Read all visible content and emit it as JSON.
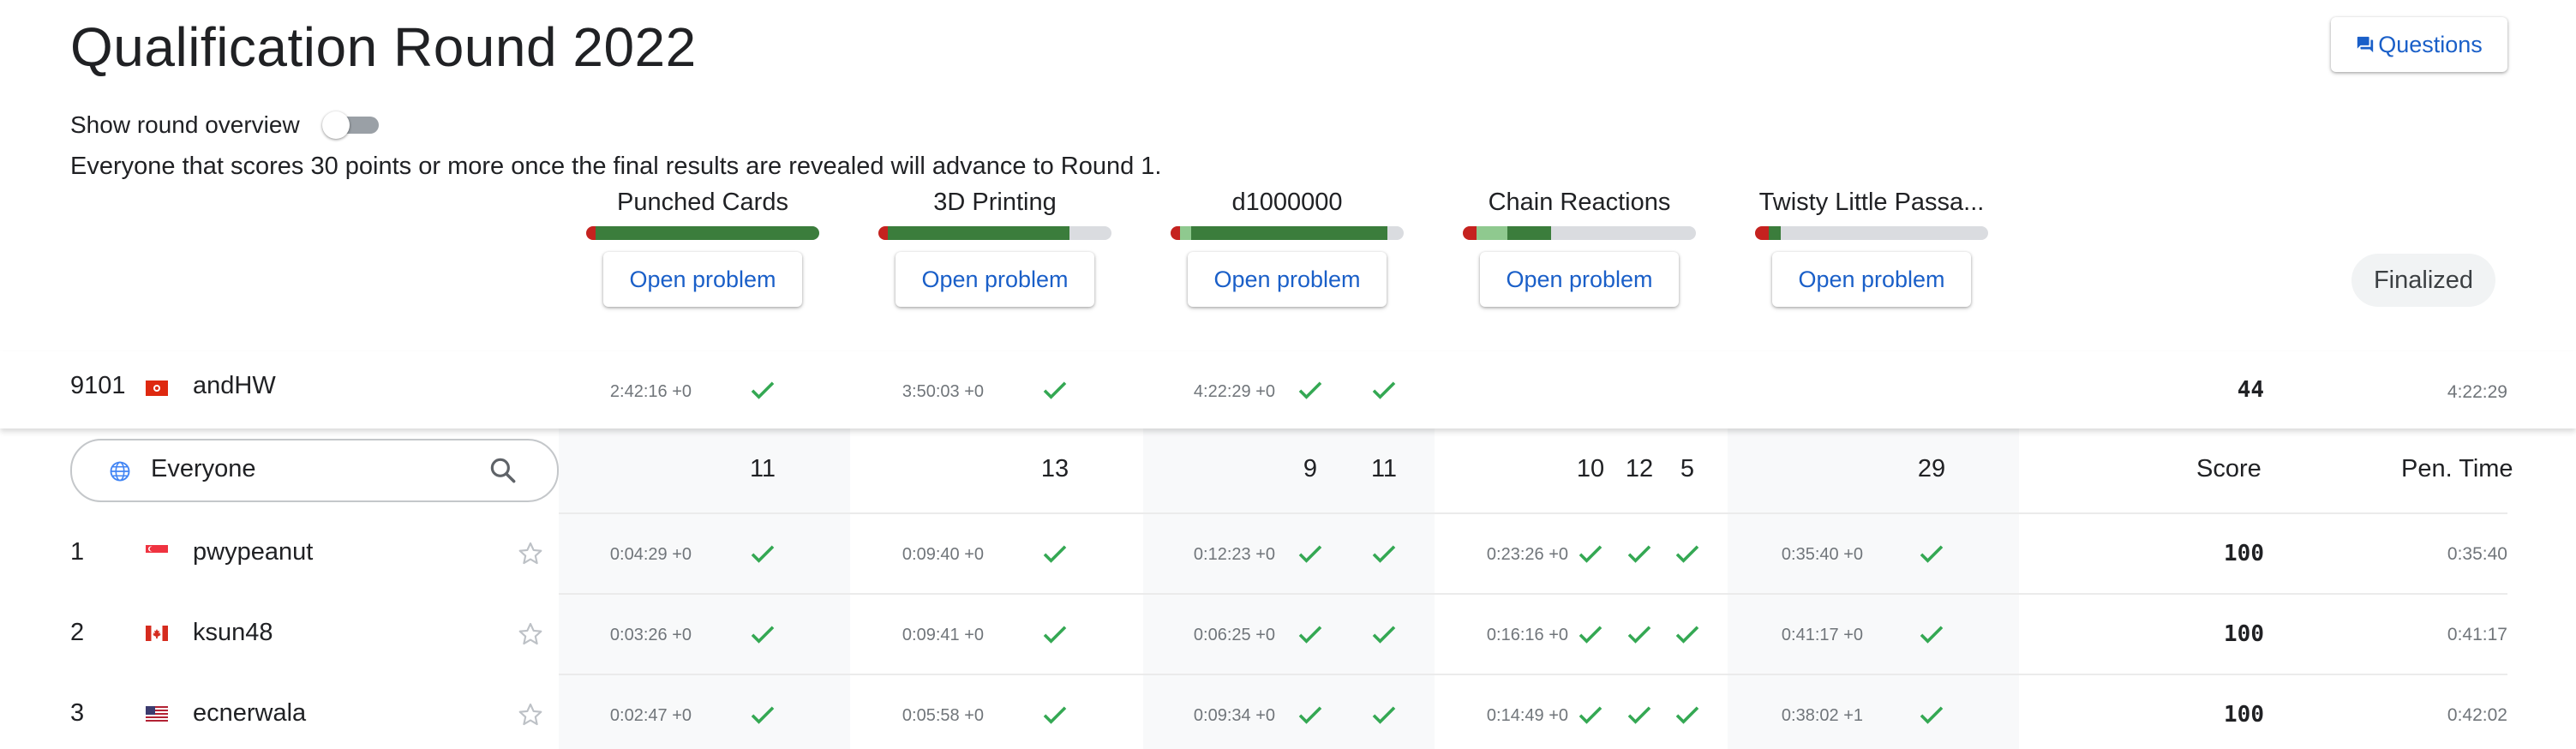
{
  "header": {
    "title": "Qualification Round 2022",
    "questions_label": "Questions",
    "show_overview_label": "Show round overview",
    "advance_text": "Everyone that scores 30 points or more once the final results are revealed will advance to Round 1."
  },
  "problems": [
    {
      "name": "Punched Cards",
      "open_label": "Open problem",
      "progress": {
        "wrong": 0.04,
        "partial": 0.0,
        "full": 0.96
      }
    },
    {
      "name": "3D Printing",
      "open_label": "Open problem",
      "progress": {
        "wrong": 0.04,
        "partial": 0.0,
        "full": 0.78
      }
    },
    {
      "name": "d1000000",
      "open_label": "Open problem",
      "progress": {
        "wrong": 0.04,
        "partial": 0.05,
        "full": 0.84
      }
    },
    {
      "name": "Chain Reactions",
      "open_label": "Open problem",
      "progress": {
        "wrong": 0.06,
        "partial": 0.13,
        "full": 0.19
      }
    },
    {
      "name": "Twisty Little Passa...",
      "open_label": "Open problem",
      "progress": {
        "wrong": 0.06,
        "partial": 0.0,
        "full": 0.05
      }
    }
  ],
  "status": {
    "finalized_label": "Finalized"
  },
  "current_user": {
    "rank": "9101",
    "flag": "hk",
    "name": "andHW",
    "times": [
      "2:42:16 +0",
      "3:50:03 +0",
      "4:22:29 +0"
    ],
    "score": "44",
    "penalty": "4:22:29"
  },
  "filter": {
    "scope_label": "Everyone",
    "globe_icon": "globe-icon",
    "search_icon": "search-icon"
  },
  "columns": {
    "counts": [
      "11",
      "13",
      "9",
      "11",
      "10",
      "12",
      "5",
      "29"
    ],
    "score_header": "Score",
    "penalty_header": "Pen. Time"
  },
  "rows": [
    {
      "rank": "1",
      "flag": "sg",
      "name": "pwypeanut",
      "times": [
        "0:04:29 +0",
        "0:09:40 +0",
        "0:12:23 +0",
        "0:23:26 +0",
        "0:35:40 +0"
      ],
      "score": "100",
      "penalty": "0:35:40"
    },
    {
      "rank": "2",
      "flag": "ca",
      "name": "ksun48",
      "times": [
        "0:03:26 +0",
        "0:09:41 +0",
        "0:06:25 +0",
        "0:16:16 +0",
        "0:41:17 +0"
      ],
      "score": "100",
      "penalty": "0:41:17"
    },
    {
      "rank": "3",
      "flag": "us",
      "name": "ecnerwala",
      "times": [
        "0:02:47 +0",
        "0:05:58 +0",
        "0:09:34 +0",
        "0:14:49 +0",
        "0:38:02 +1"
      ],
      "score": "100",
      "penalty": "0:42:02"
    }
  ],
  "colors": {
    "accent": "#1a5fc8",
    "correct": "#34a853",
    "bar_full": "#3b7d3c",
    "bar_partial": "#8fc98f",
    "bar_wrong": "#c5221f",
    "bar_empty": "#dadce0"
  }
}
